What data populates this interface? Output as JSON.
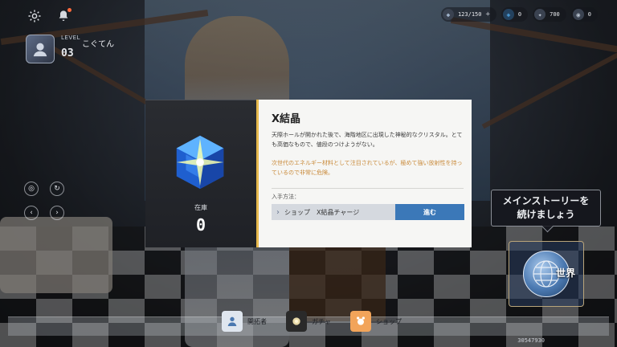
{
  "player": {
    "level_label": "LEVEL",
    "level": "03",
    "name": "こぐてん"
  },
  "resources": [
    {
      "icon": "stamina-icon",
      "value": "123/150",
      "color": "#9fb2c9"
    },
    {
      "icon": "crystal-icon",
      "value": "0",
      "color": "#4fa3e0"
    },
    {
      "icon": "feather-icon",
      "value": "700",
      "color": "#c7d1dc"
    },
    {
      "icon": "coin-icon",
      "value": "0",
      "color": "#b8c2cf"
    }
  ],
  "item_modal": {
    "title": "X結晶",
    "description": "天際ホールが開かれた後で、海階地区に出現した神秘的なクリスタル。とても高価なもので、値段のつけようがない。",
    "note": "次世代のエネルギー材料として注目されているが、極めて強い放射性を持っているので非常に危険。",
    "obtain_label": "入手方法：",
    "route_text": "ショップ　X結晶チャージ",
    "go_label": "進む",
    "stock_label": "在庫",
    "stock_value": "0",
    "accent": "#e7b94d",
    "button_color": "#3b78b8"
  },
  "story_prompt": {
    "line1": "メインストーリーを",
    "line2": "続けましょう"
  },
  "world": {
    "label": "世界"
  },
  "bottom_nav": [
    {
      "icon": "profile-icon",
      "label": "開拓者"
    },
    {
      "icon": "gacha-icon",
      "label": "ガチャ"
    },
    {
      "icon": "shop-icon",
      "label": "ショップ"
    }
  ],
  "uid": "30547930"
}
